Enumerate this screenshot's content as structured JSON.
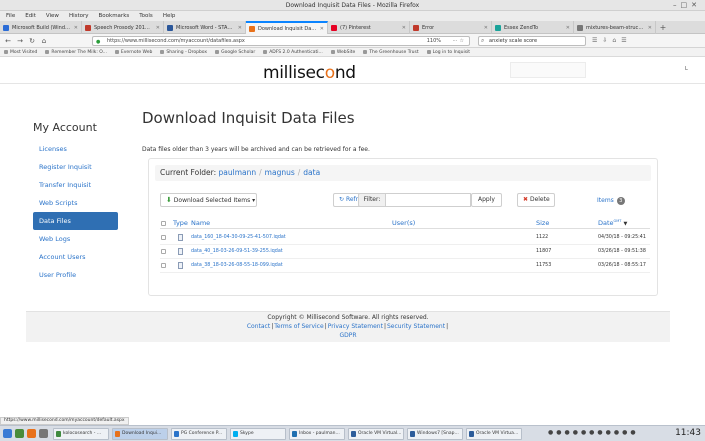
{
  "window": {
    "title": "Download Inquisit Data Files - Mozilla Firefox"
  },
  "menu": [
    "File",
    "Edit",
    "View",
    "History",
    "Bookmarks",
    "Tools",
    "Help"
  ],
  "tabs": [
    {
      "label": "Microsoft Build (Window...",
      "color": "#2b6cd6"
    },
    {
      "label": "Speech Prosody 2018 - Ro",
      "color": "#c0392b"
    },
    {
      "label": "Microsoft Word - STAND-1",
      "color": "#2b579a"
    },
    {
      "label": "Download Inquisit Data Fi",
      "color": "#e8711a",
      "active": true
    },
    {
      "label": "(7) Pinterest",
      "color": "#e60023"
    },
    {
      "label": "Error",
      "color": "#c0392b"
    },
    {
      "label": "Essex ZendTo",
      "color": "#1aa39a"
    },
    {
      "label": "mixtures-beam-structure.pdf",
      "color": "#777777"
    }
  ],
  "nav": {
    "url": "https://www.millisecond.com/myaccount/datafiles.aspx",
    "zoom": "110%",
    "search_value": "anxiety scale score"
  },
  "bookmarks": [
    "Most Visited",
    "Remember The Milk: O...",
    "Evernote Web",
    "Sharing - Dropbox",
    "Google Scholar",
    "ADFS 2.0 Authenticati...",
    "WebSite",
    "The Greenhouse Trust",
    "Log in to Inquisit"
  ],
  "site": {
    "logo_main": "millisec",
    "logo_accent": "o",
    "logo_end": "nd",
    "side_icon": "L"
  },
  "sidebar": {
    "title": "My Account",
    "items": [
      {
        "label": "Licenses"
      },
      {
        "label": "Register Inquisit"
      },
      {
        "label": "Transfer Inquisit"
      },
      {
        "label": "Web Scripts"
      },
      {
        "label": "Data Files",
        "active": true
      },
      {
        "label": "Web Logs"
      },
      {
        "label": "Account Users"
      },
      {
        "label": "User Profile"
      }
    ]
  },
  "main": {
    "title": "Download Inquisit Data Files",
    "note": "Data files older than 3 years will be archived and can be retrieved for a fee.",
    "folder": {
      "label": "Current Folder:",
      "crumbs": [
        "paulmann",
        "magnus",
        "data"
      ]
    },
    "toolbar": {
      "download": "Download Selected Items",
      "refresh": "Refresh",
      "filter_label": "Filter:",
      "filter_value": "",
      "apply": "Apply",
      "delete": "Delete",
      "items_label": "Items",
      "items_count": "3"
    },
    "table": {
      "headers": {
        "type": "Type",
        "name": "Name",
        "users": "User(s)",
        "size": "Size",
        "date": "Date",
        "date_sup": "GMT",
        "sort": "▼"
      },
      "rows": [
        {
          "name": "data_160_18-04-30-09-25-41-507.iqdat",
          "size": "1122",
          "date": "04/30/18 - 09:25:41"
        },
        {
          "name": "data_40_18-03-26-09-51-39-255.iqdat",
          "size": "11807",
          "date": "03/26/18 - 09:51:38"
        },
        {
          "name": "data_38_18-03-26-08-55-18-099.iqdat",
          "size": "11753",
          "date": "03/26/18 - 08:55:17"
        }
      ]
    }
  },
  "footer": {
    "copyright": "Copyright © Millisecond Software. All rights reserved.",
    "links": [
      "Contact",
      "Terms of Service",
      "Privacy Statement",
      "Security Statement"
    ],
    "links2": [
      "GDPR"
    ]
  },
  "status": {
    "url": "https://www.millisecond.com/myaccount/default.aspx"
  },
  "taskbar": {
    "windows": [
      {
        "label": "kolocosearch - ...",
        "color": "#3f8a3f"
      },
      {
        "label": "Download Inqui...",
        "color": "#e8711a",
        "active": true
      },
      {
        "label": "PG Conference P...",
        "color": "#2a73c9"
      },
      {
        "label": "Skype",
        "color": "#00aff0"
      },
      {
        "label": "Inbox - paulman...",
        "color": "#1f6fb0"
      },
      {
        "label": "Oracle VM Virtual...",
        "color": "#2c5c9a"
      },
      {
        "label": "Windows7 [Snap...",
        "color": "#2c5c9a"
      },
      {
        "label": "Oracle VM Virtua...",
        "color": "#2c5c9a"
      }
    ],
    "clock": "11:43"
  }
}
